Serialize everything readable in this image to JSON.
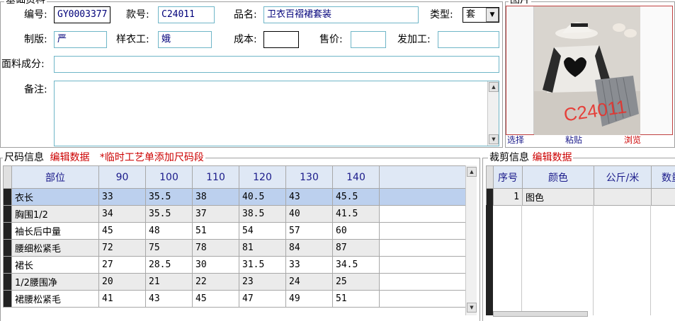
{
  "basic": {
    "section_title": "基础资料",
    "code_label": "编号:",
    "code_value": "GY0003377",
    "style_no_label": "款号:",
    "style_no_value": "C24011",
    "name_label": "品名:",
    "name_value": "卫衣百褶裙套装",
    "type_label": "类型:",
    "type_value": "套",
    "maker_label": "制版:",
    "maker_value": "严",
    "sample_worker_label": "样衣工:",
    "sample_worker_value": "娥",
    "cost_label": "成本:",
    "cost_value": "",
    "price_label": "售价:",
    "price_value": "",
    "processor_label": "发加工:",
    "processor_value": "",
    "fabric_label": "面料成分:",
    "fabric_value": "",
    "remark_label": "备注:",
    "remark_value": ""
  },
  "photo": {
    "section_title": "图片",
    "watermark": "C24011",
    "select_label": "选择",
    "paste_label": "粘贴",
    "browse_label": "浏览"
  },
  "size_info": {
    "title": "尺码信息",
    "edit_label": "编辑数据",
    "note": "*临时工艺单添加尺码段",
    "columns": [
      "部位",
      "90",
      "100",
      "110",
      "120",
      "130",
      "140"
    ],
    "rows": [
      [
        "衣长",
        "33",
        "35.5",
        "38",
        "40.5",
        "43",
        "45.5"
      ],
      [
        "胸围1/2",
        "34",
        "35.5",
        "37",
        "38.5",
        "40",
        "41.5"
      ],
      [
        "袖长后中量",
        "45",
        "48",
        "51",
        "54",
        "57",
        "60"
      ],
      [
        "腰细松紧毛",
        "72",
        "75",
        "78",
        "81",
        "84",
        "87"
      ],
      [
        "裙长",
        "27",
        "28.5",
        "30",
        "31.5",
        "33",
        "34.5"
      ],
      [
        "1/2腰围净",
        "20",
        "21",
        "22",
        "23",
        "24",
        "25"
      ],
      [
        "裙腰松紧毛",
        "41",
        "43",
        "45",
        "47",
        "49",
        "51"
      ]
    ]
  },
  "cut_info": {
    "title": "裁剪信息",
    "edit_label": "编辑数据",
    "columns": [
      "序号",
      "颜色",
      "公斤/米",
      "数量"
    ],
    "rows": [
      [
        "1",
        "图色",
        "",
        ""
      ]
    ]
  },
  "colors": {
    "field_border": "#6fb6c8",
    "header_bg": "#dfe8f5",
    "selected_row": "#bcd0ee",
    "alt_row": "#ebebeb",
    "red_text": "#cc0000"
  }
}
